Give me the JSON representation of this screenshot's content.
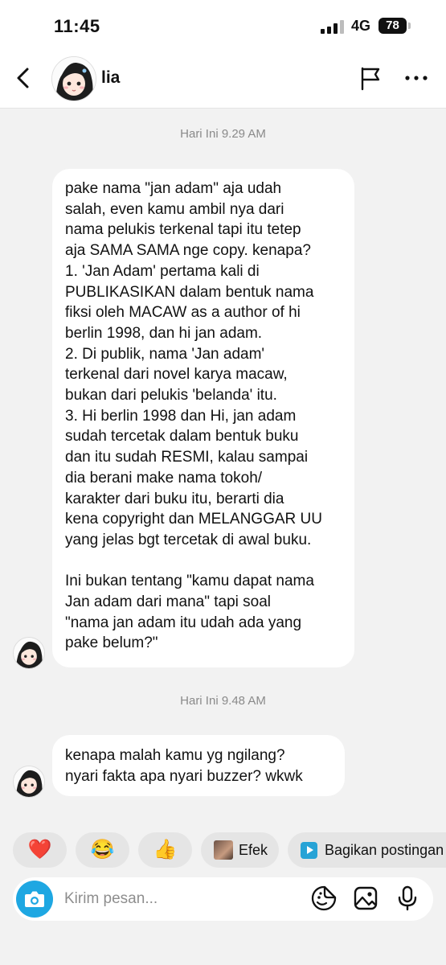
{
  "status_bar": {
    "time": "11:45",
    "network": "4G",
    "battery": "78"
  },
  "header": {
    "contact_name": "lia"
  },
  "messages": [
    {
      "timestamp": "Hari Ini 9.29 AM",
      "text": "pake nama \"jan adam\" aja udah\nsalah, even kamu ambil nya dari\nnama pelukis terkenal tapi itu tetep\naja SAMA SAMA nge copy. kenapa?\n1. 'Jan Adam' pertama kali di\nPUBLIKASIKAN dalam bentuk nama\nfiksi oleh MACAW as a author of hi\nberlin 1998, dan hi jan adam.\n2. Di publik, nama 'Jan adam'\nterkenal dari novel karya macaw,\nbukan dari pelukis 'belanda' itu.\n3. Hi berlin 1998 dan Hi, jan adam\nsudah tercetak dalam bentuk buku\ndan itu sudah RESMI, kalau sampai\ndia berani make nama tokoh/\nkarakter dari buku itu, berarti dia\nkena copyright dan MELANGGAR UU\nyang jelas bgt tercetak di awal buku.\n\nIni bukan tentang \"kamu dapat nama\nJan adam dari mana\" tapi soal\n\"nama jan adam itu udah ada yang\npake belum?\""
    },
    {
      "timestamp": "Hari Ini 9.48 AM",
      "text": "kenapa malah kamu yg ngilang?\nnyari fakta apa nyari buzzer? wkwk"
    }
  ],
  "quick_reactions": [
    {
      "icon": "heart-emoji",
      "glyph": "❤️"
    },
    {
      "icon": "laughing-tears-emoji",
      "glyph": "😂"
    },
    {
      "icon": "thumbs-up-emoji",
      "glyph": "👍"
    },
    {
      "icon": "effect-thumbnail",
      "label": "Efek"
    },
    {
      "icon": "share-post-icon",
      "label": "Bagikan postingan"
    }
  ],
  "composer": {
    "placeholder": "Kirim pesan..."
  },
  "colors": {
    "accent": "#1ea7e2",
    "background": "#f2f2f2",
    "bubble": "#ffffff",
    "chip": "#e5e5e5"
  }
}
